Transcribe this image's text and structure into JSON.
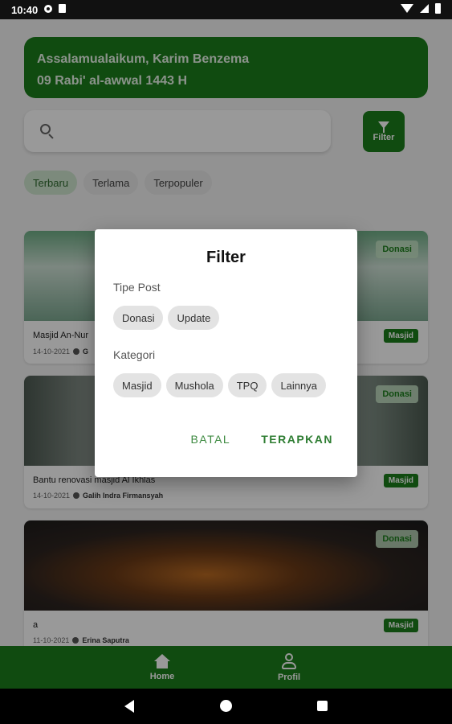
{
  "status_bar": {
    "time": "10:40"
  },
  "greeting": {
    "line1": "Assalamualaikum, Karim Benzema",
    "line2": "09 Rabi' al-awwal 1443 H"
  },
  "search": {
    "placeholder": ""
  },
  "filter_button": {
    "label": "Filter"
  },
  "sort_tabs": [
    {
      "label": "Terbaru",
      "active": true
    },
    {
      "label": "Terlama",
      "active": false
    },
    {
      "label": "Terpopuler",
      "active": false
    }
  ],
  "posts": [
    {
      "type_tag": "Donasi",
      "title": "Masjid An-Nur",
      "date": "14-10-2021",
      "author": "G",
      "category": "Masjid"
    },
    {
      "type_tag": "Donasi",
      "title": "Bantu renovasi masjid Al Ikhlas",
      "date": "14-10-2021",
      "author": "Galih Indra Firmansyah",
      "category": "Masjid"
    },
    {
      "type_tag": "Donasi",
      "title": "a",
      "date": "11-10-2021",
      "author": "Erina Saputra",
      "category": "Masjid"
    }
  ],
  "bottom_nav": [
    {
      "label": "Home",
      "icon": "home-icon"
    },
    {
      "label": "Profil",
      "icon": "profile-icon"
    }
  ],
  "dialog": {
    "title": "Filter",
    "tipe_post_label": "Tipe Post",
    "tipe_post_options": [
      "Donasi",
      "Update"
    ],
    "kategori_label": "Kategori",
    "kategori_options": [
      "Masjid",
      "Mushola",
      "TPQ",
      "Lainnya"
    ],
    "cancel_label": "BATAL",
    "apply_label": "TERAPKAN"
  },
  "colors": {
    "accent": "#1b7d1b",
    "scrim": "rgba(0,0,0,0.4)"
  }
}
